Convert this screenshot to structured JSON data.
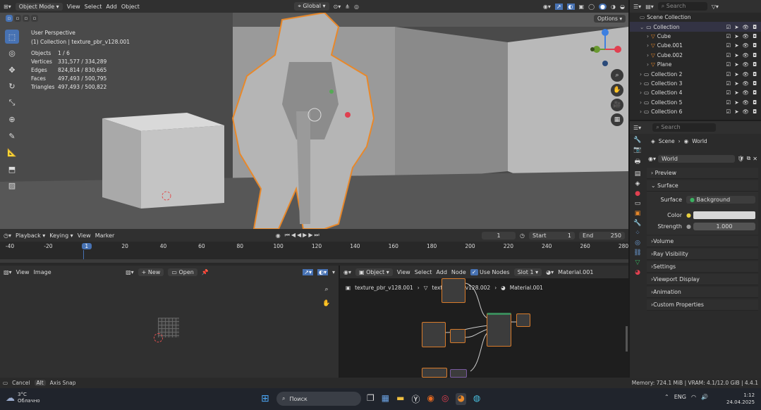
{
  "topbar": {
    "mode": "Object Mode",
    "menus": [
      "View",
      "Select",
      "Add",
      "Object"
    ],
    "orientation": "Global",
    "search_placeholder": "Search"
  },
  "viewport": {
    "perspective": "User Perspective",
    "collection": "(1) Collection | texture_pbr_v128.001",
    "stats": [
      {
        "label": "Objects",
        "value": "1 / 6"
      },
      {
        "label": "Vertices",
        "value": "331,577 / 334,289"
      },
      {
        "label": "Edges",
        "value": "824,814 / 830,665"
      },
      {
        "label": "Faces",
        "value": "497,493 / 500,795"
      },
      {
        "label": "Triangles",
        "value": "497,493 / 500,822"
      }
    ],
    "options": "Options",
    "gizmo": {
      "x": "X",
      "y": "Y",
      "z": "Z"
    }
  },
  "timeline": {
    "menus": [
      "Playback",
      "Keying",
      "View",
      "Marker"
    ],
    "current_frame": "1",
    "start_label": "Start",
    "start": "1",
    "end_label": "End",
    "end": "250",
    "ticks": [
      "-40",
      "-20",
      "1",
      "20",
      "40",
      "60",
      "80",
      "100",
      "120",
      "140",
      "160",
      "180",
      "200",
      "220",
      "240",
      "260",
      "280"
    ]
  },
  "image_editor": {
    "menus": [
      "View",
      "Image"
    ],
    "new": "New",
    "open": "Open"
  },
  "node_editor": {
    "object": "Object",
    "menus": [
      "View",
      "Select",
      "Add",
      "Node"
    ],
    "use_nodes": "Use Nodes",
    "slot": "Slot 1",
    "material": "Material.001",
    "breadcrumb": [
      "texture_pbr_v128.001",
      "texture_pbr_v128.002",
      "Material.001"
    ]
  },
  "outliner": {
    "search_placeholder": "Search",
    "root": "Scene Collection",
    "rows": [
      {
        "label": "Collection",
        "indent": 0,
        "type": "collection"
      },
      {
        "label": "Cube",
        "indent": 1,
        "type": "mesh"
      },
      {
        "label": "Cube.001",
        "indent": 1,
        "type": "mesh"
      },
      {
        "label": "Cube.002",
        "indent": 1,
        "type": "mesh"
      },
      {
        "label": "Plane",
        "indent": 1,
        "type": "mesh"
      },
      {
        "label": "Collection 2",
        "indent": 0,
        "type": "collection"
      },
      {
        "label": "Collection 3",
        "indent": 0,
        "type": "collection"
      },
      {
        "label": "Collection 4",
        "indent": 0,
        "type": "collection"
      },
      {
        "label": "Collection 5",
        "indent": 0,
        "type": "collection"
      },
      {
        "label": "Collection 6",
        "indent": 0,
        "type": "collection"
      }
    ]
  },
  "properties": {
    "search_placeholder": "Search",
    "breadcrumb": {
      "scene": "Scene",
      "world": "World"
    },
    "world_name": "World",
    "preview": "Preview",
    "surface": "Surface",
    "surface_label": "Surface",
    "surface_value": "Background",
    "color_label": "Color",
    "strength_label": "Strength",
    "strength_value": "1.000",
    "panels": [
      "Volume",
      "Ray Visibility",
      "Settings",
      "Viewport Display",
      "Animation",
      "Custom Properties"
    ]
  },
  "statusbar": {
    "cancel": "Cancel",
    "alt": "Alt",
    "axis_snap": "Axis Snap",
    "memory": "Memory: 724.1 MiB | VRAM: 4.1/12.0 GiB | 4.4.1"
  },
  "taskbar": {
    "weather_temp": "3°C",
    "weather_desc": "Облачно",
    "search": "Поиск",
    "lang": "ENG",
    "time": "1:12",
    "date": "24.04.2025"
  },
  "colors": {
    "accent": "#4772b3",
    "selection_outline": "#e8882a",
    "frame_marker": "#4772b3"
  }
}
